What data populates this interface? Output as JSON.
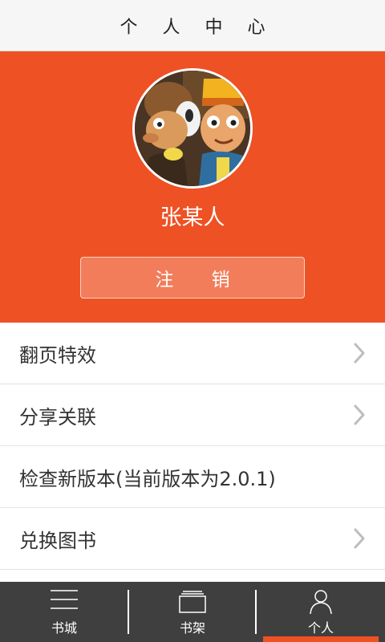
{
  "header": {
    "title": "个 人 中 心"
  },
  "profile": {
    "user_name": "张某人",
    "logout_label": "注 销"
  },
  "menu": {
    "items": [
      {
        "label": "翻页特效",
        "chevron": true
      },
      {
        "label": "分享关联",
        "chevron": true
      },
      {
        "label": "检查新版本(当前版本为2.0.1)",
        "chevron": false
      },
      {
        "label": "兑换图书",
        "chevron": true
      }
    ]
  },
  "bottom_nav": {
    "tabs": [
      {
        "label": "书城",
        "icon": "menu-lines-icon"
      },
      {
        "label": "书架",
        "icon": "bookshelf-icon"
      },
      {
        "label": "个人",
        "icon": "person-icon",
        "active": true
      }
    ]
  },
  "colors": {
    "accent": "#ee5124",
    "nav_background": "#3f3f3f",
    "title_bar": "#f6f6f6"
  }
}
